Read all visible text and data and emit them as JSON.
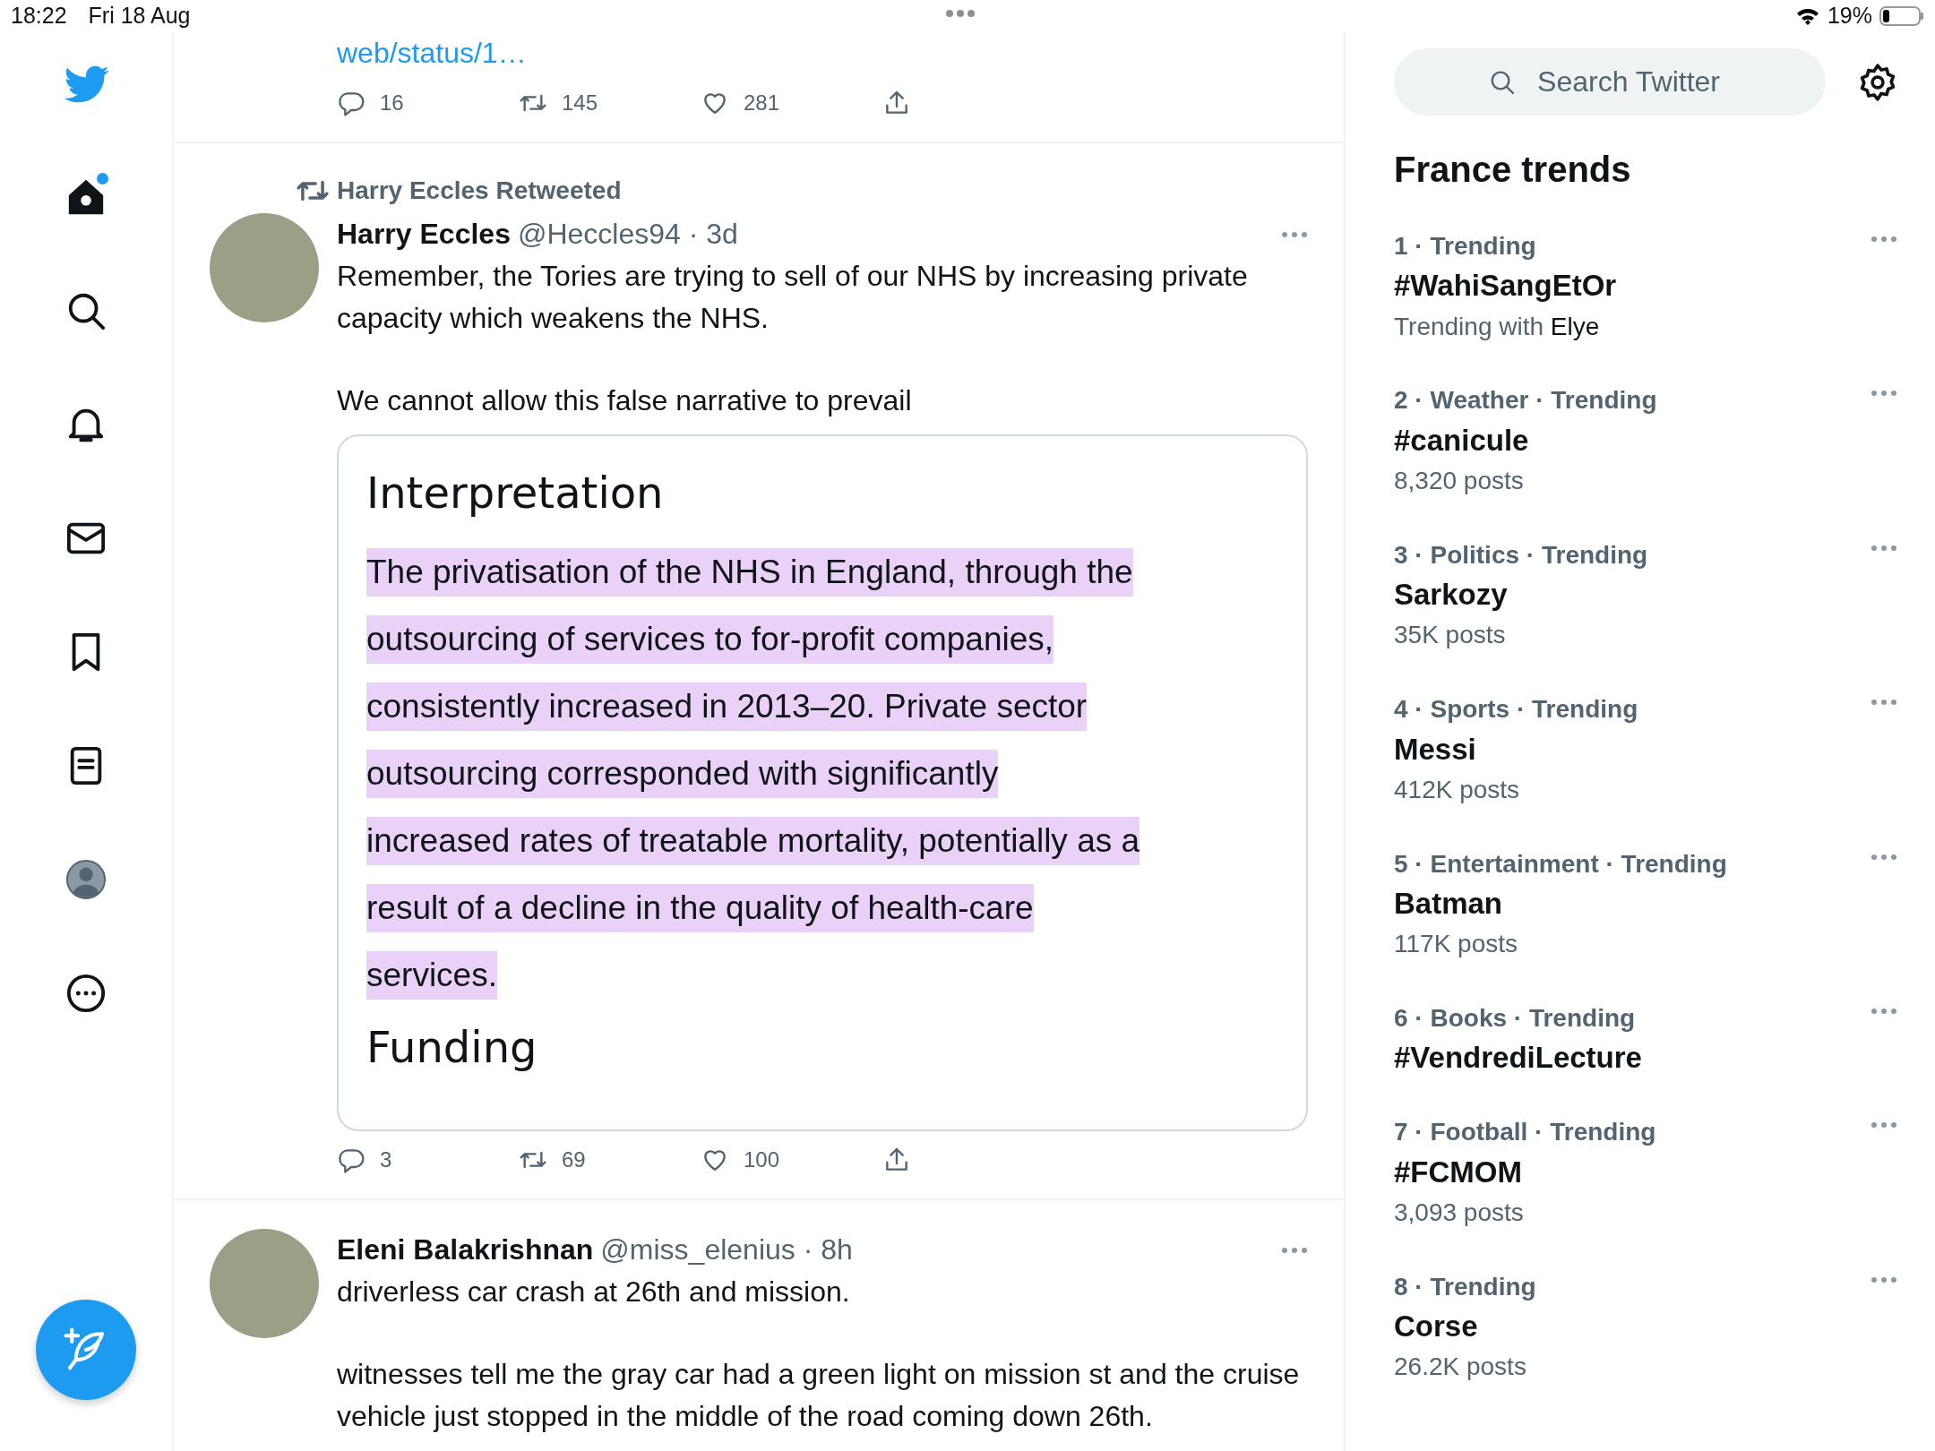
{
  "status_bar": {
    "time": "18:22",
    "date": "Fri 18 Aug",
    "battery": "19%"
  },
  "nav": [
    {
      "kind": "home",
      "unread": true
    },
    {
      "kind": "search",
      "unread": false
    },
    {
      "kind": "notifications",
      "unread": false
    },
    {
      "kind": "messages",
      "unread": false
    },
    {
      "kind": "bookmarks",
      "unread": false
    },
    {
      "kind": "lists",
      "unread": false
    },
    {
      "kind": "profile",
      "unread": false
    },
    {
      "kind": "more",
      "unread": false
    }
  ],
  "timeline": [
    {
      "kind": "tail",
      "link": "web/status/1…",
      "actions": {
        "replies": "16",
        "retweets": "145",
        "likes": "281"
      }
    },
    {
      "kind": "tweet",
      "retweeted_by": "Harry Eccles Retweeted",
      "name": "Harry Eccles",
      "handle": "@Heccles94 · 3d",
      "paragraphs": [
        "Remember, the Tories are trying to sell of our NHS by increasing private capacity which weakens the NHS.",
        "We cannot allow this false narrative to prevail"
      ],
      "card": {
        "title": "Interpretation",
        "highlighted_lines": [
          "The privatisation of the NHS in England, through the",
          "outsourcing of services to for-profit companies,",
          "consistently increased in 2013–20. Private sector",
          "outsourcing corresponded with significantly",
          "increased rates of treatable mortality, potentially as a",
          "result of a decline in the quality of health-care",
          "services."
        ],
        "next_heading": "Funding"
      },
      "actions": {
        "replies": "3",
        "retweets": "69",
        "likes": "100"
      }
    },
    {
      "kind": "tweet",
      "name": "Eleni Balakrishnan",
      "handle": "@miss_elenius · 8h",
      "paragraphs": [
        "driverless car crash at 26th and mission.",
        "witnesses tell me the gray car had a green light on mission st and the cruise vehicle just stopped in the middle of the road coming down 26th."
      ]
    }
  ],
  "search": {
    "placeholder": "Search Twitter"
  },
  "trends": {
    "title": "France trends",
    "items": [
      {
        "meta": "1 · Trending",
        "name": "#WahiSangEtOr",
        "context": "Trending with",
        "context_name": "Elye"
      },
      {
        "meta": "2 · Weather · Trending",
        "name": "#canicule",
        "posts": "8,320 posts"
      },
      {
        "meta": "3 · Politics · Trending",
        "name": "Sarkozy",
        "posts": "35K posts"
      },
      {
        "meta": "4 · Sports · Trending",
        "name": "Messi",
        "posts": "412K posts"
      },
      {
        "meta": "5 · Entertainment · Trending",
        "name": "Batman",
        "posts": "117K posts"
      },
      {
        "meta": "6 · Books · Trending",
        "name": "#VendrediLecture"
      },
      {
        "meta": "7 · Football · Trending",
        "name": "#FCMOM",
        "posts": "3,093 posts"
      },
      {
        "meta": "8 · Trending",
        "name": "Corse",
        "posts": "26.2K posts"
      }
    ]
  }
}
